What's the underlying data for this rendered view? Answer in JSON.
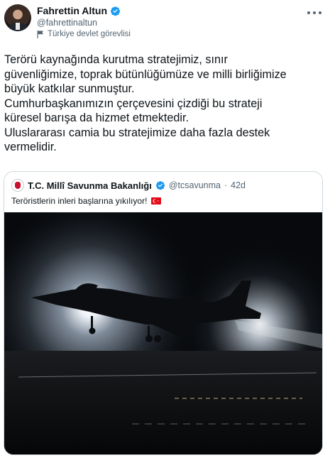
{
  "author": {
    "display_name": "Fahrettin Altun",
    "handle": "@fahrettinaltun",
    "label": "Türkiye devlet görevlisi"
  },
  "tweet": {
    "lines": [
      "Terörü kaynağında kurutma stratejimiz, sınır",
      "güvenliğimize, toprak bütünlüğümüze ve milli birliğimize",
      "büyük katkılar sunmuştur.",
      "Cumhurbaşkanımızın çerçevesini çizdiği bu strateji",
      "küresel barışa da hizmet etmektedir.",
      "Uluslararası camia bu stratejimize daha fazla destek",
      "vermelidir."
    ]
  },
  "quoted_tweet": {
    "display_name": "T.C. Millî Savunma Bakanlığı",
    "handle": "@tcsavunma",
    "separator": "·",
    "time": "42d",
    "text": "Teröristlerin inleri başlarına yıkılıyor!",
    "media_description_icon": "fighter-jet-night-photo"
  },
  "icons": {
    "verified": "verified-badge-icon",
    "label": "flag-icon",
    "more": "more-icon",
    "country_flag": "turkey-flag-icon"
  },
  "colors": {
    "verified_blue": "#1d9bf0",
    "secondary_text": "#536471",
    "border": "#cfd9de",
    "turkey_red": "#e30a17"
  }
}
